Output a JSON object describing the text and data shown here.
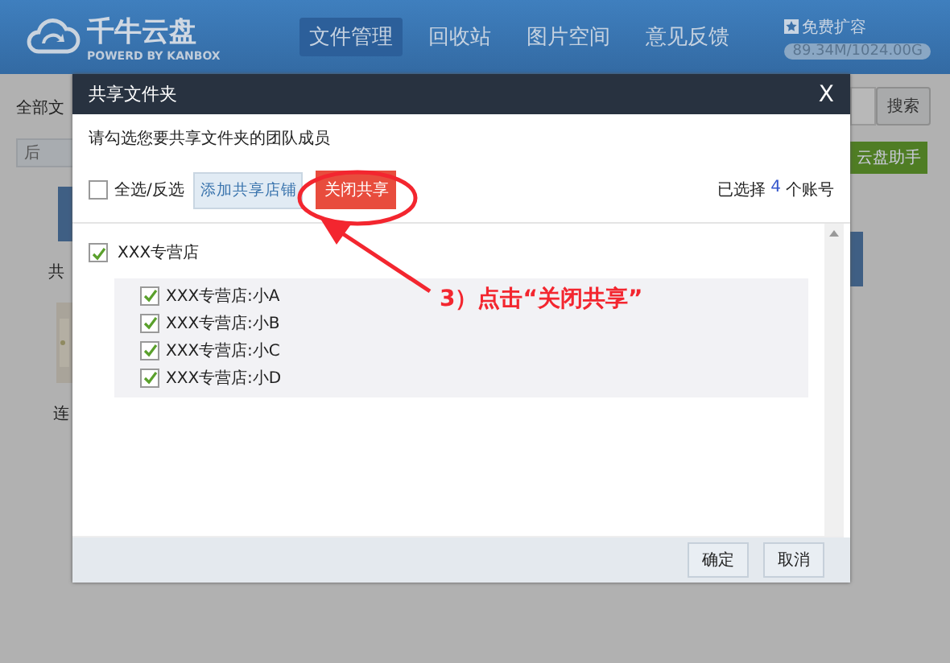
{
  "header": {
    "logo": {
      "name": "千牛云盘",
      "tagline": "POWERD BY KANBOX"
    },
    "nav": [
      {
        "label": "文件管理",
        "selected": true
      },
      {
        "label": "回收站",
        "selected": false
      },
      {
        "label": "图片空间",
        "selected": false
      },
      {
        "label": "意见反馈",
        "selected": false
      }
    ],
    "upgrade": "免费扩容",
    "capacity": "89.34M/1024.00G"
  },
  "background": {
    "left": {
      "breadcrumb": "全部文",
      "back_button": "后",
      "folder_label": "共",
      "picture_label": "连"
    },
    "right": {
      "search_button": "搜索",
      "assistant_button": "云盘助手"
    }
  },
  "dialog": {
    "title": "共享文件夹",
    "close": "X",
    "instruction": "请勾选您要共享文件夹的团队成员",
    "select_all": {
      "label": "全选/反选",
      "checked": false
    },
    "add_button": "添加共享店铺",
    "close_share_button": "关闭共享",
    "selected_count": {
      "prefix": "已选择",
      "count": "4",
      "suffix": "个账号"
    },
    "members": [
      {
        "name": "XXX专营店",
        "checked": true,
        "children": [
          {
            "name": "XXX专营店:小A",
            "checked": true
          },
          {
            "name": "XXX专营店:小B",
            "checked": true
          },
          {
            "name": "XXX专营店:小C",
            "checked": true
          },
          {
            "name": "XXX专营店:小D",
            "checked": true
          }
        ]
      }
    ],
    "buttons": [
      "确定",
      "取消"
    ]
  },
  "annotation": {
    "text": "3）点击“关闭共享”"
  }
}
